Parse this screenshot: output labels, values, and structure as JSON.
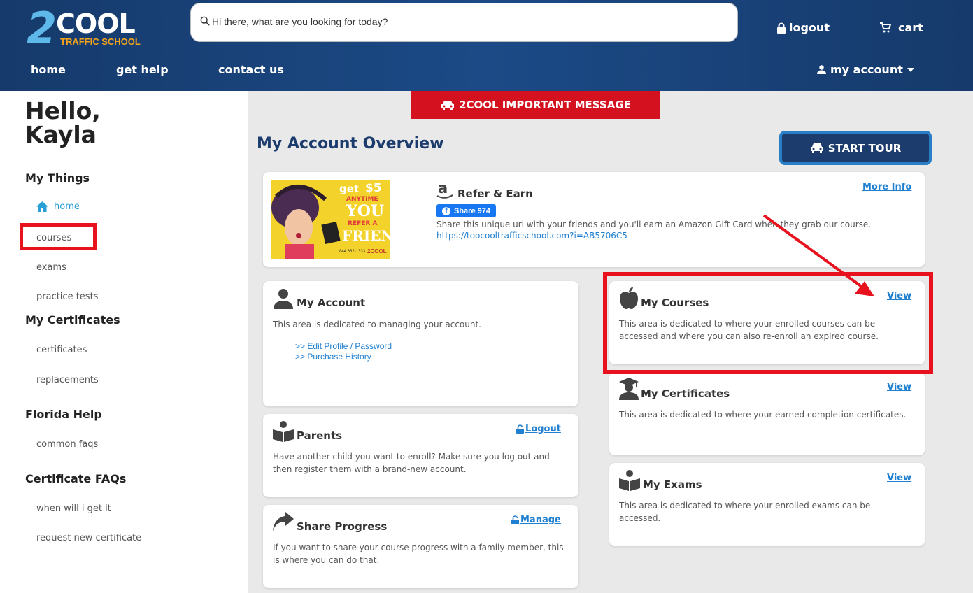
{
  "header": {
    "logo": {
      "big": "2",
      "word": "COOL",
      "sub": "TRAFFIC SCHOOL"
    },
    "search": {
      "placeholder": "Hi there, what are you looking for today?"
    },
    "logout_label": "logout",
    "cart_label": "cart",
    "nav": [
      {
        "label": "home"
      },
      {
        "label": "get help"
      },
      {
        "label": "contact us"
      }
    ],
    "account_label": "my account"
  },
  "sidebar": {
    "greeting_line1": "Hello,",
    "greeting_line2": "Kayla",
    "sections": [
      {
        "title": "My Things",
        "items": [
          {
            "label": "home",
            "icon": "home-icon"
          },
          {
            "label": "courses"
          },
          {
            "label": "exams"
          },
          {
            "label": "practice tests"
          }
        ]
      },
      {
        "title": "My Certificates",
        "items": [
          {
            "label": "certificates"
          },
          {
            "label": "replacements"
          }
        ]
      },
      {
        "title": "Florida Help",
        "items": [
          {
            "label": "common faqs"
          }
        ]
      },
      {
        "title": "Certificate FAQs",
        "items": [
          {
            "label": "when will i get it"
          },
          {
            "label": "request new certificate"
          }
        ]
      }
    ]
  },
  "main": {
    "important_label": "2COOL IMPORTANT MESSAGE",
    "title": "My Account Overview",
    "tour_label": "START TOUR",
    "refer": {
      "promo": {
        "get": "get",
        "amount": "$5",
        "anytime": "ANYTIME",
        "you": "YOU",
        "refer": "REFER A",
        "friend": "FRIEND",
        "phone": "844 662-1333",
        "brand": "2COOL"
      },
      "title": "Refer & Earn",
      "more_info": "More Info",
      "share_label": "Share 974",
      "text": "Share this unique url with your friends and you'll earn an Amazon Gift Card when they grab our course.",
      "url": "https://toocooltrafficschool.com?i=AB5706C5"
    },
    "my_account": {
      "title": "My Account",
      "text": "This area is dedicated to managing your account.",
      "link1": ">> Edit Profile / Password",
      "link2": ">> Purchase History"
    },
    "parents": {
      "title": "Parents",
      "action": "Logout",
      "text": "Have another child you want to enroll? Make sure you log out and then register them with a brand-new account."
    },
    "share_progress": {
      "title": "Share Progress",
      "action": "Manage",
      "text": "If you want to share your course progress with a family member, this is where you can do that."
    },
    "my_courses": {
      "title": "My Courses",
      "action": "View",
      "text": "This area is dedicated to where your enrolled courses can be accessed and where you can also re-enroll an expired course."
    },
    "my_certificates": {
      "title": "My Certificates",
      "action": "View",
      "text": "This area is dedicated to where your earned completion certificates."
    },
    "my_exams": {
      "title": "My Exams",
      "action": "View",
      "text": "This area is dedicated to where your enrolled exams can be accessed."
    }
  },
  "colors": {
    "header_blue": "#1b4a86",
    "accent_red": "#d4111f",
    "link_blue": "#1f7fd0",
    "highlight_red": "#e8121f"
  }
}
